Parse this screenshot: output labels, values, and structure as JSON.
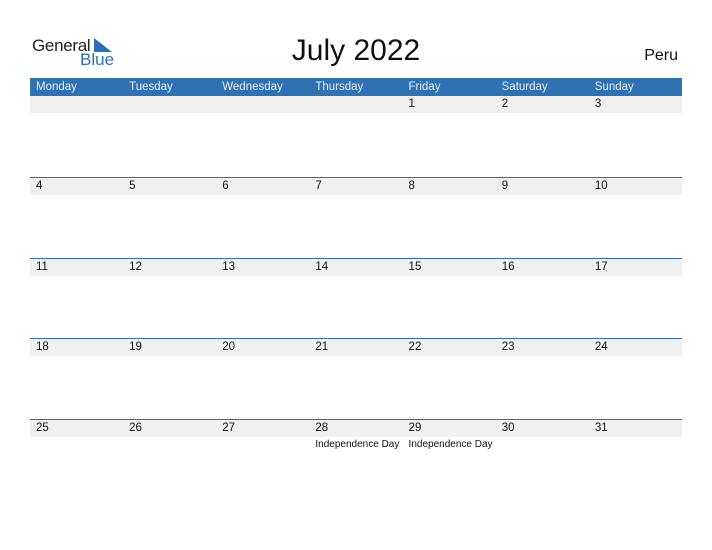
{
  "logo": {
    "general": "General",
    "blue": "Blue",
    "accent": "#2a6fba"
  },
  "title": "July 2022",
  "country": "Peru",
  "colors": {
    "header_bg": "#2e72b4",
    "date_strip": "#f0f0f0"
  },
  "weekdays": [
    "Monday",
    "Tuesday",
    "Wednesday",
    "Thursday",
    "Friday",
    "Saturday",
    "Sunday"
  ],
  "weeks": [
    [
      {
        "d": ""
      },
      {
        "d": ""
      },
      {
        "d": ""
      },
      {
        "d": ""
      },
      {
        "d": "1"
      },
      {
        "d": "2"
      },
      {
        "d": "3"
      }
    ],
    [
      {
        "d": "4"
      },
      {
        "d": "5"
      },
      {
        "d": "6"
      },
      {
        "d": "7"
      },
      {
        "d": "8"
      },
      {
        "d": "9"
      },
      {
        "d": "10"
      }
    ],
    [
      {
        "d": "11"
      },
      {
        "d": "12"
      },
      {
        "d": "13"
      },
      {
        "d": "14"
      },
      {
        "d": "15"
      },
      {
        "d": "16"
      },
      {
        "d": "17"
      }
    ],
    [
      {
        "d": "18"
      },
      {
        "d": "19"
      },
      {
        "d": "20"
      },
      {
        "d": "21"
      },
      {
        "d": "22"
      },
      {
        "d": "23"
      },
      {
        "d": "24"
      }
    ],
    [
      {
        "d": "25"
      },
      {
        "d": "26"
      },
      {
        "d": "27"
      },
      {
        "d": "28",
        "e": "Independence Day"
      },
      {
        "d": "29",
        "e": "Independence Day"
      },
      {
        "d": "30"
      },
      {
        "d": "31"
      }
    ]
  ]
}
